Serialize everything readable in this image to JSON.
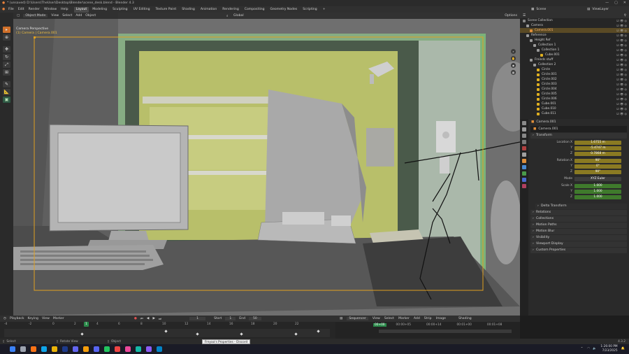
{
  "titlebar": {
    "title": "* (unsaved) D:\\Users\\TheUser\\Desktop\\Blender\\scene_desk.blend - Blender 4.3",
    "min": "—",
    "max": "▢",
    "close": "✕"
  },
  "menubar": {
    "menus": [
      "File",
      "Edit",
      "Render",
      "Window",
      "Help"
    ],
    "workspaces": [
      "Layout",
      "Modeling",
      "Sculpting",
      "UV Editing",
      "Texture Paint",
      "Shading",
      "Animation",
      "Rendering",
      "Compositing",
      "Geometry Nodes",
      "Scripting"
    ],
    "active_workspace": "Layout",
    "scene_label": "Scene",
    "viewlayer_label": "ViewLayer"
  },
  "viewport_header": {
    "mode": "Object Mode",
    "view": "View",
    "select": "Select",
    "add": "Add",
    "object": "Object",
    "transform": "Global",
    "options": "Options"
  },
  "viewport": {
    "camera_title": "Camera Perspective",
    "camera_sub": "(1) Camera | Camera.001"
  },
  "outliner": {
    "header": "Scene Collection",
    "rows": [
      {
        "label": "Scene Collection",
        "indent": 0,
        "icon": "#888888"
      },
      {
        "label": "Camera",
        "indent": 1,
        "icon": "#9a9a9a"
      },
      {
        "label": "Camera.001",
        "indent": 2,
        "icon": "#e08f3a",
        "selected": true
      },
      {
        "label": "Reference",
        "indent": 1,
        "icon": "#9a9a9a"
      },
      {
        "label": "Height Ref",
        "indent": 2,
        "icon": "#9a9a9a"
      },
      {
        "label": "Collection 1",
        "indent": 3,
        "icon": "#9a9a9a"
      },
      {
        "label": "Collection 1",
        "indent": 4,
        "icon": "#9a9a9a"
      },
      {
        "label": "Cube.001",
        "indent": 5,
        "icon": "#e0b020"
      },
      {
        "label": "Freinds stuff",
        "indent": 2,
        "icon": "#9a9a9a"
      },
      {
        "label": "Collection 2",
        "indent": 3,
        "icon": "#9a9a9a"
      },
      {
        "label": "Circle",
        "indent": 4,
        "icon": "#e0b020"
      },
      {
        "label": "Circle.001",
        "indent": 4,
        "icon": "#e0b020"
      },
      {
        "label": "Circle.002",
        "indent": 4,
        "icon": "#e0b020"
      },
      {
        "label": "Circle.003",
        "indent": 4,
        "icon": "#e0b020"
      },
      {
        "label": "Circle.004",
        "indent": 4,
        "icon": "#e0b020"
      },
      {
        "label": "Circle.005",
        "indent": 4,
        "icon": "#e0b020"
      },
      {
        "label": "Circle.006",
        "indent": 4,
        "icon": "#e0b020"
      },
      {
        "label": "Cube.001",
        "indent": 4,
        "icon": "#e0b020"
      },
      {
        "label": "Cube.010",
        "indent": 4,
        "icon": "#e0b020"
      },
      {
        "label": "Cube.011",
        "indent": 4,
        "icon": "#e0b020"
      }
    ]
  },
  "properties": {
    "object_name_top": "Camera.001",
    "object_name_field": "Camera.001",
    "transform_header": "Transform",
    "location_label": "Location X",
    "loc": [
      {
        "axis": "Location X",
        "val": "1.6755 m"
      },
      {
        "axis": "Y",
        "val": "-5.4747 m"
      },
      {
        "axis": "Z",
        "val": "0.7868 m"
      }
    ],
    "rotation_label": "Rotation X",
    "rot": [
      {
        "axis": "Rotation X",
        "val": "90°"
      },
      {
        "axis": "Y",
        "val": "0°"
      },
      {
        "axis": "Z",
        "val": "90°"
      }
    ],
    "mode_label": "Mode",
    "mode_val": "XYZ Euler",
    "scale": [
      {
        "axis": "Scale X",
        "val": "1.000"
      },
      {
        "axis": "Y",
        "val": "1.000"
      },
      {
        "axis": "Z",
        "val": "1.000"
      }
    ],
    "sections": [
      "Delta Transform",
      "Relations",
      "Collections",
      "Motion Paths",
      "Motion Blur",
      "Visibility",
      "Viewport Display",
      "Custom Properties"
    ]
  },
  "timeline": {
    "playback": "Playback",
    "keying": "Keying",
    "view": "View",
    "marker": "Marker",
    "current_frame": "1",
    "start_label": "Start",
    "start": "1",
    "end_label": "End",
    "end": "50",
    "ticks": [
      "-4",
      "-2",
      "0",
      "2",
      "4",
      "6",
      "8",
      "10",
      "12",
      "14",
      "16",
      "18",
      "20",
      "22"
    ],
    "playhead": "1"
  },
  "sequencer": {
    "mode": "Sequencer",
    "menus": [
      "View",
      "Select",
      "Marker",
      "Add",
      "Strip",
      "Image"
    ],
    "overlay": "Shading",
    "times": [
      "00+00",
      "00:00+05",
      "00:00+14",
      "00:01+00",
      "00:01+08"
    ]
  },
  "statusbar": {
    "select": "Select",
    "rotate": "Rotate View",
    "object": "Object",
    "version": "4.3.2"
  },
  "tooltip": "Freyaa's Properties - Discord",
  "taskbar": {
    "time": "1:26:00 PM",
    "date": "7/23/2025",
    "icons": [
      {
        "name": "start",
        "color": "#3b82f6"
      },
      {
        "name": "search",
        "color": "#9ca3af"
      },
      {
        "name": "firefox",
        "color": "#f97316"
      },
      {
        "name": "edge",
        "color": "#0ea5e9"
      },
      {
        "name": "explorer",
        "color": "#eab308"
      },
      {
        "name": "steam",
        "color": "#1e3a8a"
      },
      {
        "name": "store",
        "color": "#6366f1"
      },
      {
        "name": "blender",
        "color": "#f59e0b"
      },
      {
        "name": "discord",
        "color": "#5865f2"
      },
      {
        "name": "chrome",
        "color": "#22c55e"
      },
      {
        "name": "app-a",
        "color": "#ef4444"
      },
      {
        "name": "app-b",
        "color": "#ec4899"
      },
      {
        "name": "app-c",
        "color": "#14b8a6"
      },
      {
        "name": "app-d",
        "color": "#8b5cf6"
      },
      {
        "name": "app-e",
        "color": "#0284c7"
      }
    ]
  }
}
